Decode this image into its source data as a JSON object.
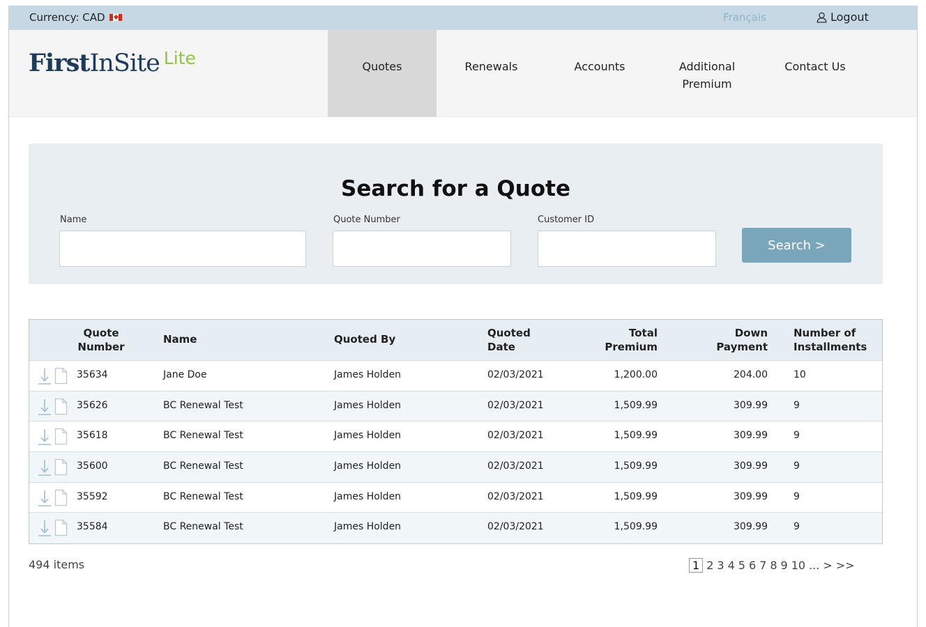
{
  "topbar": {
    "currency": "Currency: CAD",
    "flag_icon": "canada-flag-icon",
    "language": "Français",
    "logout": "Logout",
    "logout_icon": "user-icon"
  },
  "logo": {
    "first": "First",
    "insite": "InSite",
    "lite": "Lite"
  },
  "nav": {
    "items": [
      {
        "label": "Quotes",
        "line2": "",
        "active": true
      },
      {
        "label": "Renewals",
        "line2": "",
        "active": false
      },
      {
        "label": "Accounts",
        "line2": "",
        "active": false
      },
      {
        "label": "Additional",
        "line2": "Premium",
        "active": false
      },
      {
        "label": "Contact Us",
        "line2": "",
        "active": false
      }
    ]
  },
  "search": {
    "title_bold": "Search",
    "title_rest": "for a Quote",
    "fields": [
      {
        "label": "Name",
        "value": ""
      },
      {
        "label": "Quote Number",
        "value": ""
      },
      {
        "label": "Customer ID",
        "value": ""
      }
    ],
    "button": "Search >"
  },
  "table": {
    "headers": {
      "quote_number": [
        "Quote",
        "Number"
      ],
      "name": "Name",
      "quoted_by": "Quoted By",
      "quoted_date": [
        "Quoted",
        "Date"
      ],
      "total_premium": [
        "Total",
        "Premium"
      ],
      "down_payment": [
        "Down",
        "Payment"
      ],
      "installments": [
        "Number of",
        "Installments"
      ]
    },
    "row_icons": [
      "download-icon",
      "document-icon"
    ],
    "rows": [
      {
        "quote_number": "35634",
        "name": "Jane Doe",
        "quoted_by": "James Holden",
        "quoted_date": "02/03/2021",
        "total_premium": "1,200.00",
        "down_payment": "204.00",
        "installments": "10"
      },
      {
        "quote_number": "35626",
        "name": "BC Renewal Test",
        "quoted_by": "James Holden",
        "quoted_date": "02/03/2021",
        "total_premium": "1,509.99",
        "down_payment": "309.99",
        "installments": "9"
      },
      {
        "quote_number": "35618",
        "name": "BC Renewal Test",
        "quoted_by": "James Holden",
        "quoted_date": "02/03/2021",
        "total_premium": "1,509.99",
        "down_payment": "309.99",
        "installments": "9"
      },
      {
        "quote_number": "35600",
        "name": "BC Renewal Test",
        "quoted_by": "James Holden",
        "quoted_date": "02/03/2021",
        "total_premium": "1,509.99",
        "down_payment": "309.99",
        "installments": "9"
      },
      {
        "quote_number": "35592",
        "name": "BC Renewal Test",
        "quoted_by": "James Holden",
        "quoted_date": "02/03/2021",
        "total_premium": "1,509.99",
        "down_payment": "309.99",
        "installments": "9"
      },
      {
        "quote_number": "35584",
        "name": "BC Renewal Test",
        "quoted_by": "James Holden",
        "quoted_date": "02/03/2021",
        "total_premium": "1,509.99",
        "down_payment": "309.99",
        "installments": "9"
      }
    ]
  },
  "footer": {
    "items_count": "494 items",
    "pages": [
      "1",
      "2",
      "3",
      "4",
      "5",
      "6",
      "7",
      "8",
      "9",
      "10",
      "...",
      ">",
      ">>"
    ],
    "current_page": "1"
  },
  "colors": {
    "topbar_bg": "#c6d8e4",
    "logo_navy": "#1d3b5c",
    "logo_green": "#8dc63f",
    "search_button": "#7aa6bb",
    "language_link": "#8fb5cc"
  }
}
